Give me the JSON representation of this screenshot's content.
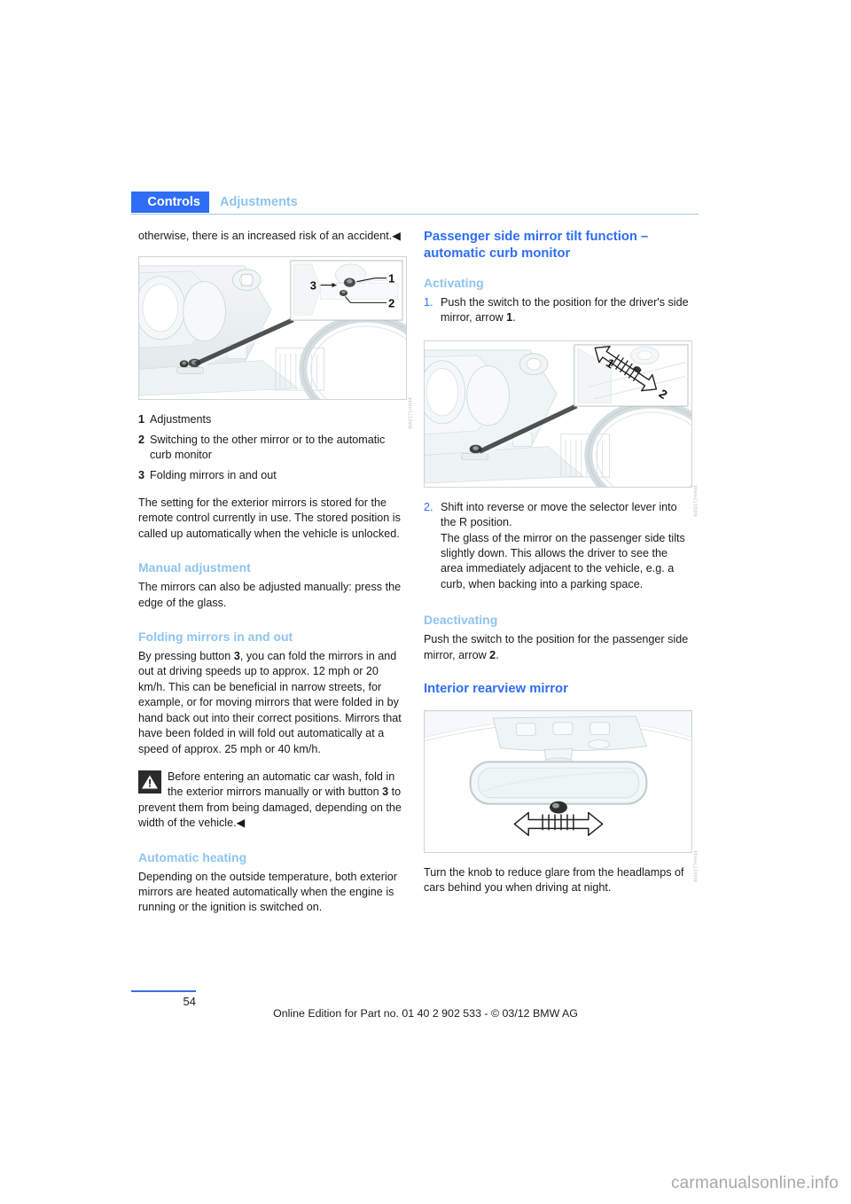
{
  "header": {
    "tab_label": "Controls",
    "section_label": "Adjustments"
  },
  "left_column": {
    "intro_text": "otherwise, there is an increased risk of an accident.◀",
    "figure": {
      "name": "exterior-mirror-switch-figure",
      "code": "MA0171HH44",
      "callouts": [
        "1",
        "2",
        "3"
      ]
    },
    "legend": [
      {
        "num": "1",
        "text": "Adjustments"
      },
      {
        "num": "2",
        "text": "Switching to the other mirror or to the automatic curb monitor"
      },
      {
        "num": "3",
        "text": "Folding mirrors in and out"
      }
    ],
    "stored_setting_text": "The setting for the exterior mirrors is stored for the remote control currently in use. The stored position is called up automatically when the vehicle is unlocked.",
    "manual_adjustment": {
      "heading": "Manual adjustment",
      "text": "The mirrors can also be adjusted manually: press the edge of the glass."
    },
    "folding_mirrors": {
      "heading": "Folding mirrors in and out",
      "text_part1": "By pressing button ",
      "bold1": "3",
      "text_part2": ", you can fold the mirrors in and out at driving speeds up to approx. 12 mph or 20 km/h. This can be beneficial in narrow streets, for example, or for moving mirrors that were folded in by hand back out into their correct positions. Mirrors that have been folded in will fold out automatically at a speed of approx. 25 mph or 40 km/h."
    },
    "warning": {
      "icon": "warning-triangle-icon",
      "text_part1": "Before entering an automatic car wash, fold in the exterior mirrors manually or with button ",
      "bold1": "3",
      "text_part2": " to prevent them from being damaged, depending on the width of the vehicle.◀"
    },
    "automatic_heating": {
      "heading": "Automatic heating",
      "text": "Depending on the outside temperature, both exterior mirrors are heated automatically when the engine is running or the ignition is switched on."
    }
  },
  "right_column": {
    "main_heading": "Passenger side mirror tilt function – automatic curb monitor",
    "activating": {
      "heading": "Activating",
      "step1_num": "1.",
      "step1_part1": "Push the switch to the position for the driver's side mirror, arrow ",
      "step1_bold": "1",
      "step1_part2": ".",
      "step2_num": "2.",
      "step2_text": "Shift into reverse or move the selector lever into the R position.\nThe glass of the mirror on the passenger side tilts slightly down. This allows the driver to see the area immediately adjacent to the vehicle, e.g. a curb, when backing into a parking space."
    },
    "figure_switch": {
      "name": "mirror-switch-arrows-figure",
      "code": "MA0172HH44",
      "callouts": [
        "1",
        "2"
      ]
    },
    "deactivating": {
      "heading": "Deactivating",
      "text_part1": "Push the switch to the position for the passenger side mirror, arrow ",
      "bold1": "2",
      "text_part2": "."
    },
    "interior_mirror": {
      "heading": "Interior rearview mirror",
      "figure_code": "MA0177HH44",
      "text": "Turn the knob to reduce glare from the headlamps of cars behind you when driving at night."
    }
  },
  "footer": {
    "page_number": "54",
    "edition_line": "Online Edition for Part no. 01 40 2 902 533 - © 03/12 BMW AG"
  },
  "watermark": "carmanualsonline.info",
  "colors": {
    "accent_blue": "#2f6df6",
    "light_blue": "#8ec4ef",
    "rule_blue": "#9cc8ee",
    "text": "#1b1b1b"
  }
}
